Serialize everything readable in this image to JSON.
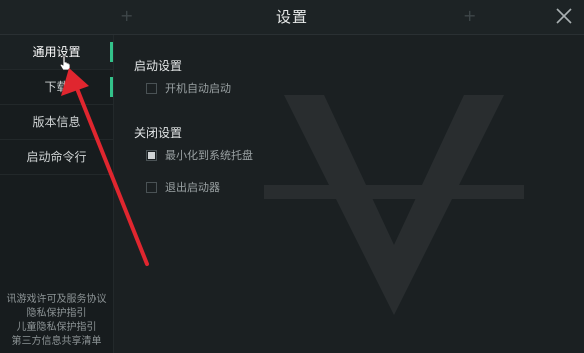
{
  "window": {
    "title": "设置"
  },
  "sidebar": {
    "items": [
      {
        "label": "通用设置",
        "active": true
      },
      {
        "label": "下载",
        "active": false
      },
      {
        "label": "版本信息",
        "active": false
      },
      {
        "label": "启动命令行",
        "active": false
      }
    ],
    "links": [
      "讯游戏许可及服务协议",
      "隐私保护指引",
      "儿童隐私保护指引",
      "第三方信息共享清单"
    ]
  },
  "content": {
    "startup": {
      "title": "启动设置",
      "auto_start_label": "开机自动启动",
      "auto_start_checked": false
    },
    "close": {
      "title": "关闭设置",
      "minimize_label": "最小化到系统托盘",
      "minimize_checked": true,
      "exit_label": "退出启动器",
      "exit_checked": false
    }
  },
  "colors": {
    "accent": "#33c28a",
    "annotation": "#e0262f"
  }
}
